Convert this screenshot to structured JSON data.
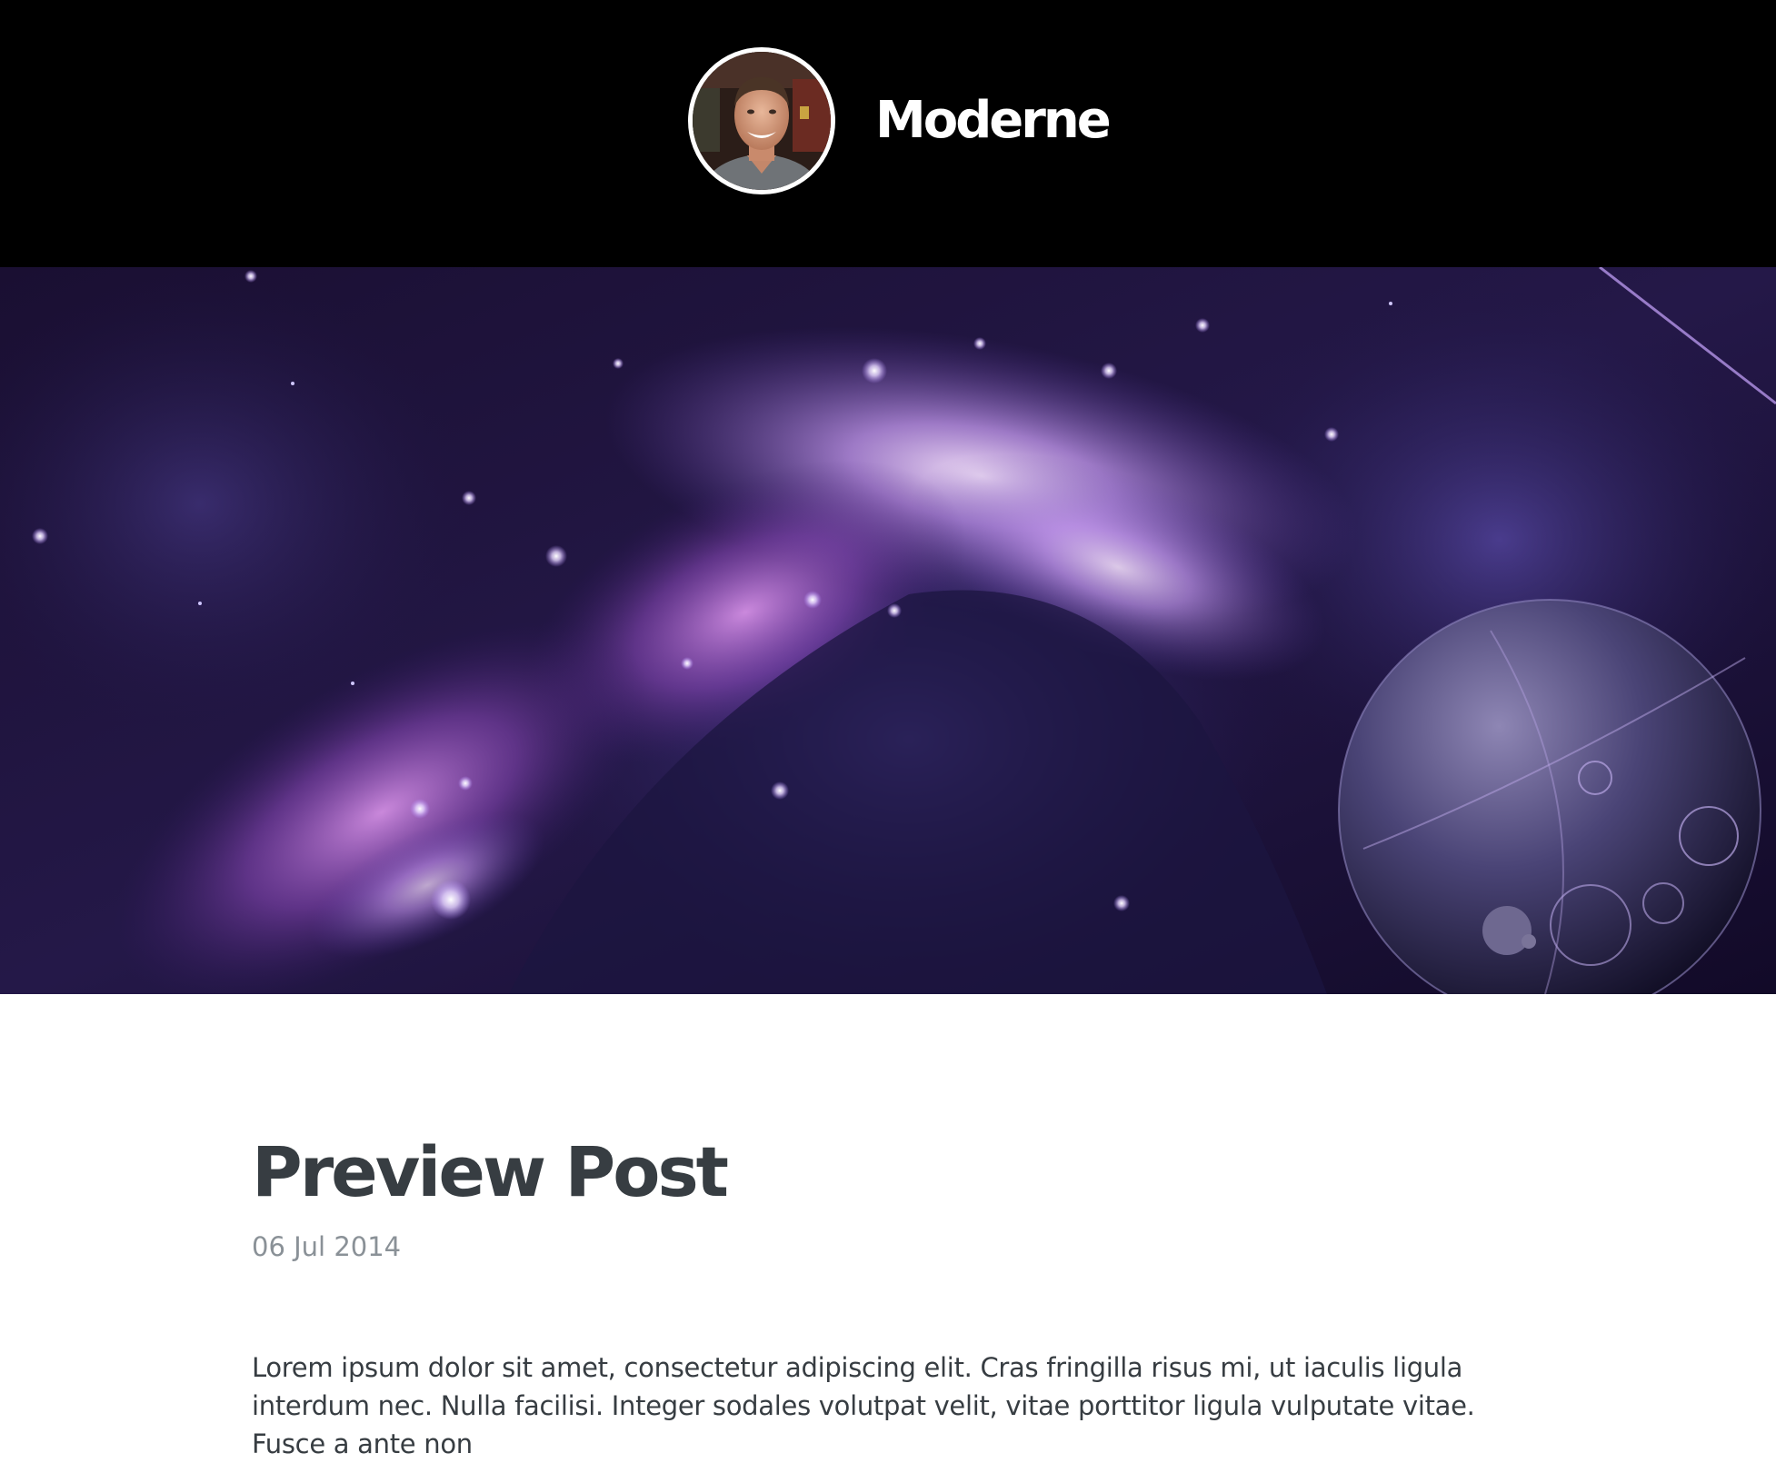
{
  "site": {
    "title": "Moderne",
    "avatar_alt": "author avatar"
  },
  "hero": {
    "alt": "space nebula with planet"
  },
  "post": {
    "title": "Preview Post",
    "date": "06 Jul 2014",
    "body": "Lorem ipsum dolor sit amet, consectetur adipiscing elit. Cras fringilla risus mi, ut iaculis ligula interdum nec. Nulla facilisi. Integer sodales volutpat velit, vitae porttitor ligula vulputate vitae. Fusce a ante non"
  },
  "colors": {
    "header_bg": "#000000",
    "title_text": "#373d42",
    "date_text": "#8a9197"
  }
}
